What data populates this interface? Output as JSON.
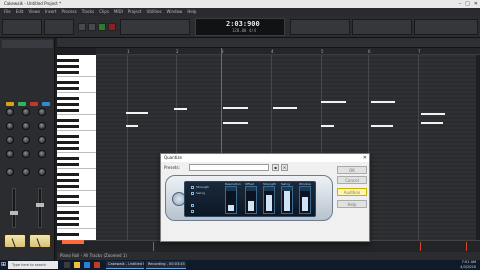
{
  "window": {
    "title": "Cakewalk - Untitled Project *"
  },
  "menu": [
    "File",
    "Edit",
    "Views",
    "Insert",
    "Process",
    "Tracks",
    "Clips",
    "MIDI",
    "Project",
    "Utilities",
    "Window",
    "Help"
  ],
  "transport": {
    "time": "2:03:900",
    "tempo": "120.00  4/4"
  },
  "ruler": {
    "marks": [
      "1",
      "2",
      "3",
      "4",
      "5",
      "6",
      "7"
    ]
  },
  "dialog": {
    "title": "Quantize",
    "preset_label": "Presets:",
    "buttons": [
      "OK",
      "Cancel",
      "Audition",
      "Help"
    ],
    "plugin": {
      "strength_label": "Strength",
      "swing_label": "Swing",
      "columns": [
        "Resolution",
        "Offset",
        "Strength",
        "Swing",
        "Window"
      ]
    }
  },
  "status": {
    "text": "Piano Roll - All Tracks (Zoomed 1)"
  },
  "taskbar": {
    "search_placeholder": "Type here to search",
    "apps": [
      "Cakewalk - Untitled P...",
      "Recording - 00:03:45"
    ],
    "clock_time": "7:01 AM",
    "clock_date": "4/3/2020"
  },
  "colors": {
    "accent": "#ff6a3a",
    "note": "#f2f2f2",
    "dialog_highlight": "#fff7b0"
  }
}
